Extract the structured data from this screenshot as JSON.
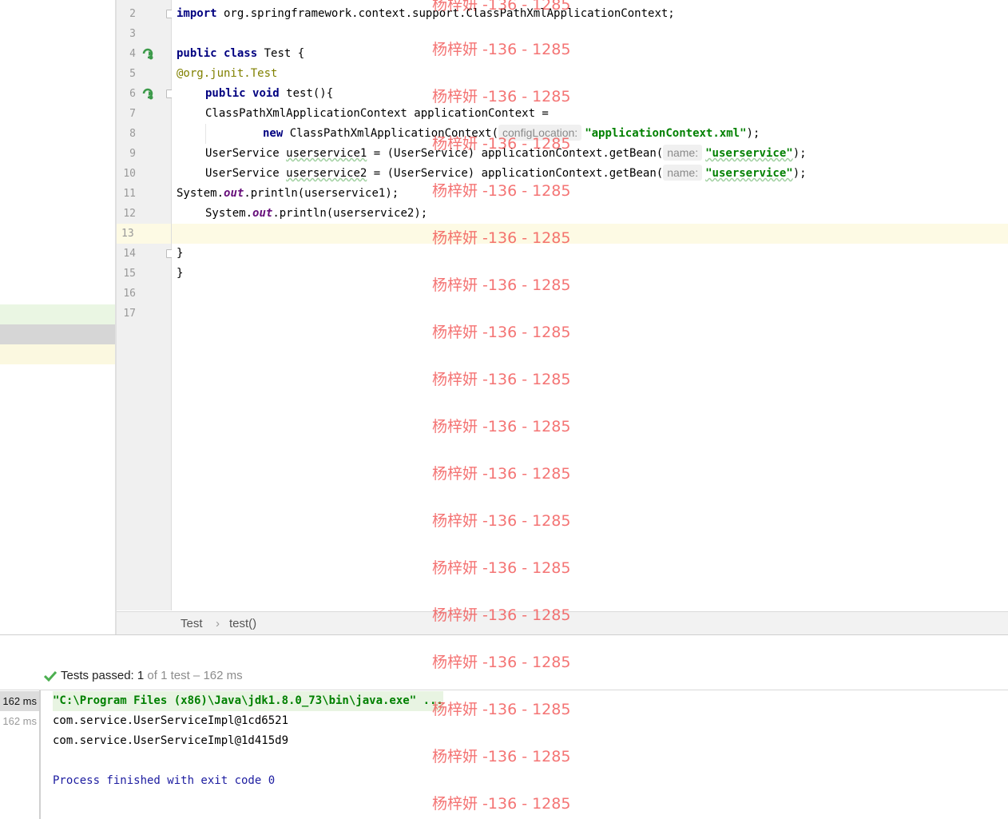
{
  "editor": {
    "line_numbers": [
      "2",
      "3",
      "4",
      "5",
      "6",
      "7",
      "8",
      "9",
      "10",
      "11",
      "12",
      "13",
      "14",
      "15",
      "16",
      "17"
    ],
    "lines": {
      "l2": {
        "kw": "import",
        "rest": " org.springframework.context.support.ClassPathXmlApplicationContext;"
      },
      "l4": {
        "kw1": "public",
        "kw2": "class",
        "rest": " Test {"
      },
      "l5": {
        "at": "@org.junit.",
        "ann": "Test"
      },
      "l6": {
        "kw1": "public",
        "kw2": "void",
        "rest": " test(){"
      },
      "l7": {
        "text": "ClassPathXmlApplicationContext applicationContext ="
      },
      "l8": {
        "kw": "new",
        "call": " ClassPathXmlApplicationContext(",
        "hint": "configLocation:",
        "str": "\"applicationContext.xml\"",
        "end": ");"
      },
      "l9": {
        "type": "UserService ",
        "var": "userservice1",
        "mid": " = (UserService) applicationContext.getBean(",
        "hint": "name:",
        "str": "\"userservice\"",
        "end": ");"
      },
      "l10": {
        "type": "UserService ",
        "var": "userservice2",
        "mid": " = (UserService) applicationContext.getBean(",
        "hint": "name:",
        "str": "\"userservice\"",
        "end": ");"
      },
      "l11": {
        "sys": "System.",
        "fld": "out",
        "rest": ".println(userservice1);"
      },
      "l12": {
        "sys": "System.",
        "fld": "out",
        "rest": ".println(userservice2);"
      },
      "l14": {
        "text": "}"
      },
      "l15": {
        "text": "}"
      }
    }
  },
  "breadcrumb": {
    "class": "Test",
    "sep": "›",
    "method": "test()"
  },
  "run": {
    "status_label": "Tests passed: ",
    "status_count": "1",
    "status_rest": " of 1 test – 162 ms",
    "tree": [
      "162 ms",
      "162 ms"
    ],
    "console": [
      "\"C:\\Program Files (x86)\\Java\\jdk1.8.0_73\\bin\\java.exe\" ...",
      "com.service.UserServiceImpl@1cd6521",
      "com.service.UserServiceImpl@1d415d9",
      "",
      "Process finished with exit code 0"
    ]
  },
  "watermark": "杨梓妍 -136 - 1285",
  "colors": {
    "keyword": "#000080",
    "string": "#008000",
    "annotation": "#808000",
    "field": "#660e7a",
    "caret_line": "#fdfae4",
    "pass_green": "#4caf50"
  }
}
